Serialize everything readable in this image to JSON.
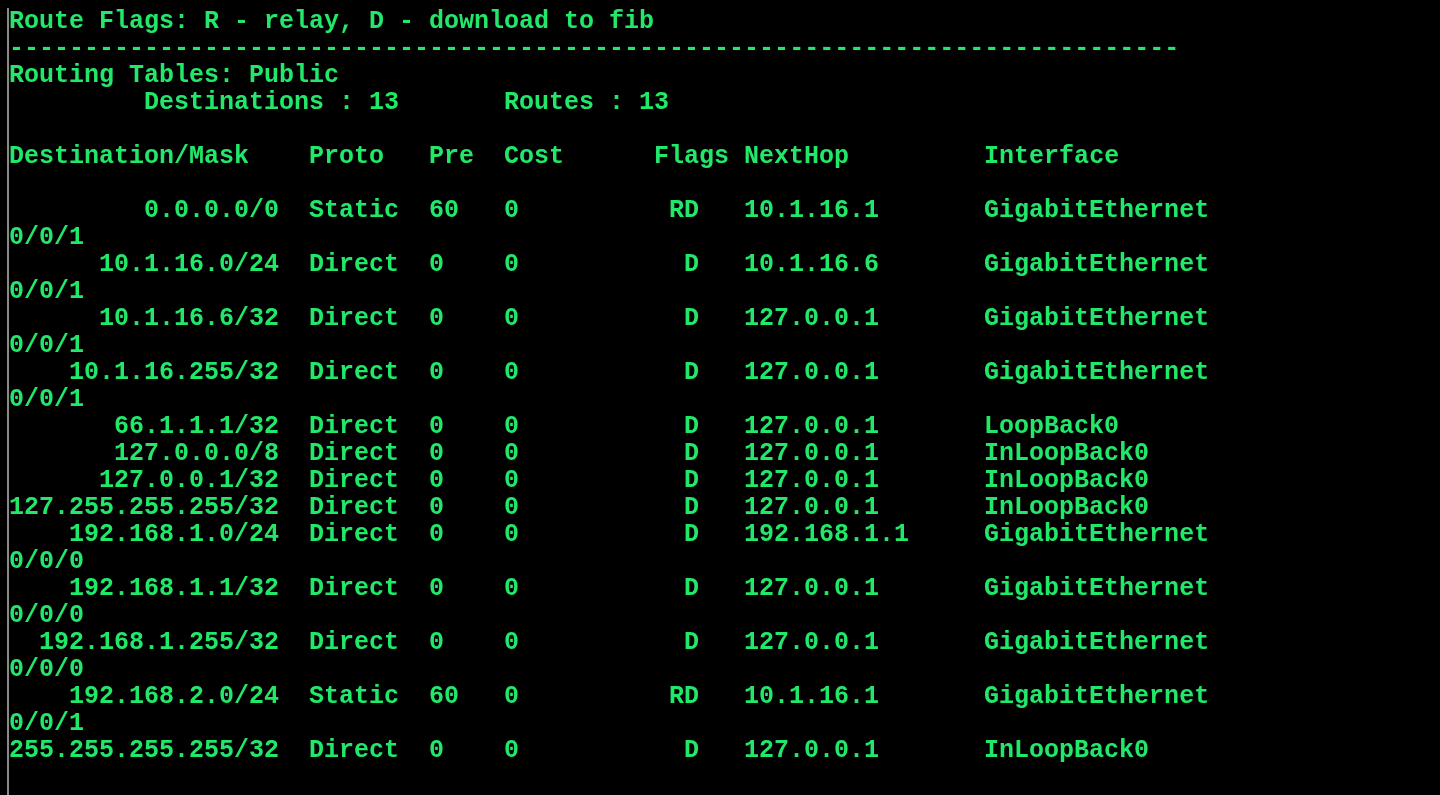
{
  "legend": "Route Flags: R - relay, D - download to fib",
  "separator": "------------------------------------------------------------------------------",
  "table_title": "Routing Tables: Public",
  "summary": {
    "destinations": "Destinations : 13",
    "routes": "Routes : 13"
  },
  "columns": [
    "Destination/Mask",
    "Proto",
    "Pre",
    "Cost",
    "Flags",
    "NextHop",
    "Interface"
  ],
  "rows": [
    {
      "destination": "0.0.0.0/0",
      "proto": "Static",
      "pre": "60",
      "cost": "0",
      "flags": "RD",
      "nexthop": "10.1.16.1",
      "interface": "GigabitEthernet",
      "interface_wrap": "0/0/1"
    },
    {
      "destination": "10.1.16.0/24",
      "proto": "Direct",
      "pre": "0",
      "cost": "0",
      "flags": "D",
      "nexthop": "10.1.16.6",
      "interface": "GigabitEthernet",
      "interface_wrap": "0/0/1"
    },
    {
      "destination": "10.1.16.6/32",
      "proto": "Direct",
      "pre": "0",
      "cost": "0",
      "flags": "D",
      "nexthop": "127.0.0.1",
      "interface": "GigabitEthernet",
      "interface_wrap": "0/0/1"
    },
    {
      "destination": "10.1.16.255/32",
      "proto": "Direct",
      "pre": "0",
      "cost": "0",
      "flags": "D",
      "nexthop": "127.0.0.1",
      "interface": "GigabitEthernet",
      "interface_wrap": "0/0/1"
    },
    {
      "destination": "66.1.1.1/32",
      "proto": "Direct",
      "pre": "0",
      "cost": "0",
      "flags": "D",
      "nexthop": "127.0.0.1",
      "interface": "LoopBack0"
    },
    {
      "destination": "127.0.0.0/8",
      "proto": "Direct",
      "pre": "0",
      "cost": "0",
      "flags": "D",
      "nexthop": "127.0.0.1",
      "interface": "InLoopBack0"
    },
    {
      "destination": "127.0.0.1/32",
      "proto": "Direct",
      "pre": "0",
      "cost": "0",
      "flags": "D",
      "nexthop": "127.0.0.1",
      "interface": "InLoopBack0"
    },
    {
      "destination": "127.255.255.255/32",
      "proto": "Direct",
      "pre": "0",
      "cost": "0",
      "flags": "D",
      "nexthop": "127.0.0.1",
      "interface": "InLoopBack0"
    },
    {
      "destination": "192.168.1.0/24",
      "proto": "Direct",
      "pre": "0",
      "cost": "0",
      "flags": "D",
      "nexthop": "192.168.1.1",
      "interface": "GigabitEthernet",
      "interface_wrap": "0/0/0"
    },
    {
      "destination": "192.168.1.1/32",
      "proto": "Direct",
      "pre": "0",
      "cost": "0",
      "flags": "D",
      "nexthop": "127.0.0.1",
      "interface": "GigabitEthernet",
      "interface_wrap": "0/0/0"
    },
    {
      "destination": "192.168.1.255/32",
      "proto": "Direct",
      "pre": "0",
      "cost": "0",
      "flags": "D",
      "nexthop": "127.0.0.1",
      "interface": "GigabitEthernet",
      "interface_wrap": "0/0/0"
    },
    {
      "destination": "192.168.2.0/24",
      "proto": "Static",
      "pre": "60",
      "cost": "0",
      "flags": "RD",
      "nexthop": "10.1.16.1",
      "interface": "GigabitEthernet",
      "interface_wrap": "0/0/1"
    },
    {
      "destination": "255.255.255.255/32",
      "proto": "Direct",
      "pre": "0",
      "cost": "0",
      "flags": "D",
      "nexthop": "127.0.0.1",
      "interface": "InLoopBack0"
    }
  ]
}
